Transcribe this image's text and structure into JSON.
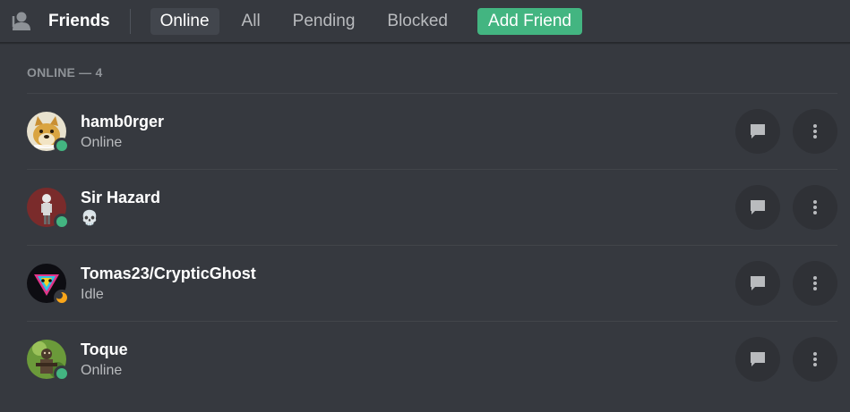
{
  "header": {
    "title": "Friends",
    "tabs": [
      {
        "label": "Online",
        "active": true
      },
      {
        "label": "All",
        "active": false
      },
      {
        "label": "Pending",
        "active": false
      },
      {
        "label": "Blocked",
        "active": false
      }
    ],
    "add_friend_label": "Add Friend"
  },
  "section": {
    "header": "ONLINE — 4"
  },
  "friends": [
    {
      "name": "hamb0rger",
      "status_text": "Online",
      "presence": "online",
      "avatar": "doge-avatar"
    },
    {
      "name": "Sir Hazard",
      "status_text": "💀",
      "presence": "online",
      "avatar": "skeleton-avatar"
    },
    {
      "name": "Tomas23/CrypticGhost",
      "status_text": "Idle",
      "presence": "idle",
      "avatar": "triangle-avatar"
    },
    {
      "name": "Toque",
      "status_text": "Online",
      "presence": "online",
      "avatar": "soldier-avatar"
    }
  ],
  "colors": {
    "online": "#43b581",
    "idle": "#faa61a",
    "add_friend": "#43b581",
    "background": "#36393f"
  },
  "icons": {
    "friends": "friends-icon",
    "message": "message-icon",
    "more": "more-vertical-icon"
  }
}
